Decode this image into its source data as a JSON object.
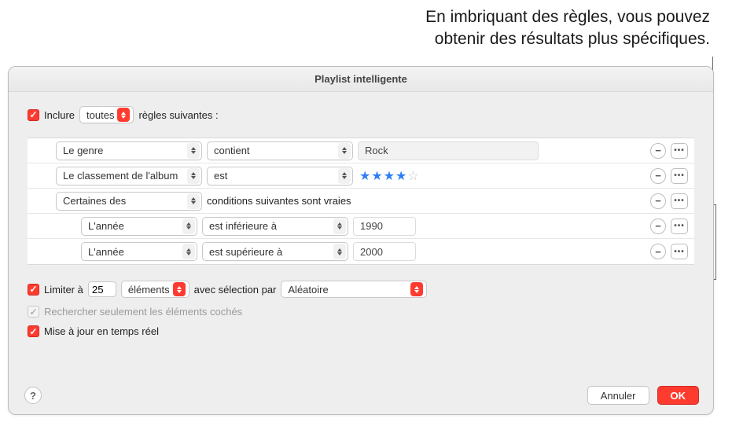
{
  "caption_line1": "En imbriquant des règles, vous pouvez",
  "caption_line2": "obtenir des résultats plus spécifiques.",
  "dialog": {
    "title": "Playlist intelligente",
    "include_prefix": "Inclure",
    "include_mode": "toutes",
    "include_suffix": "règles suivantes :",
    "rules": [
      {
        "field": "Le genre",
        "op": "contient",
        "value": "Rock",
        "type": "text"
      },
      {
        "field": "Le classement de l'album",
        "op": "est",
        "type": "stars",
        "stars_full": 4,
        "stars_total": 5
      },
      {
        "field": "Certaines des",
        "suffix": "conditions suivantes sont vraies",
        "type": "group"
      },
      {
        "field": "L'année",
        "op": "est inférieure à",
        "value": "1990",
        "type": "year",
        "nested": true
      },
      {
        "field": "L'année",
        "op": "est supérieure à",
        "value": "2000",
        "type": "year",
        "nested": true
      }
    ],
    "limit": {
      "label_prefix": "Limiter à",
      "count": "25",
      "unit": "éléments",
      "by_label": "avec sélection par",
      "by_value": "Aléatoire"
    },
    "only_checked": "Rechercher seulement les éléments cochés",
    "live_update": "Mise à jour en temps réel",
    "help": "?",
    "cancel": "Annuler",
    "ok": "OK",
    "icons": {
      "minus": "−",
      "dots": "•••"
    }
  }
}
